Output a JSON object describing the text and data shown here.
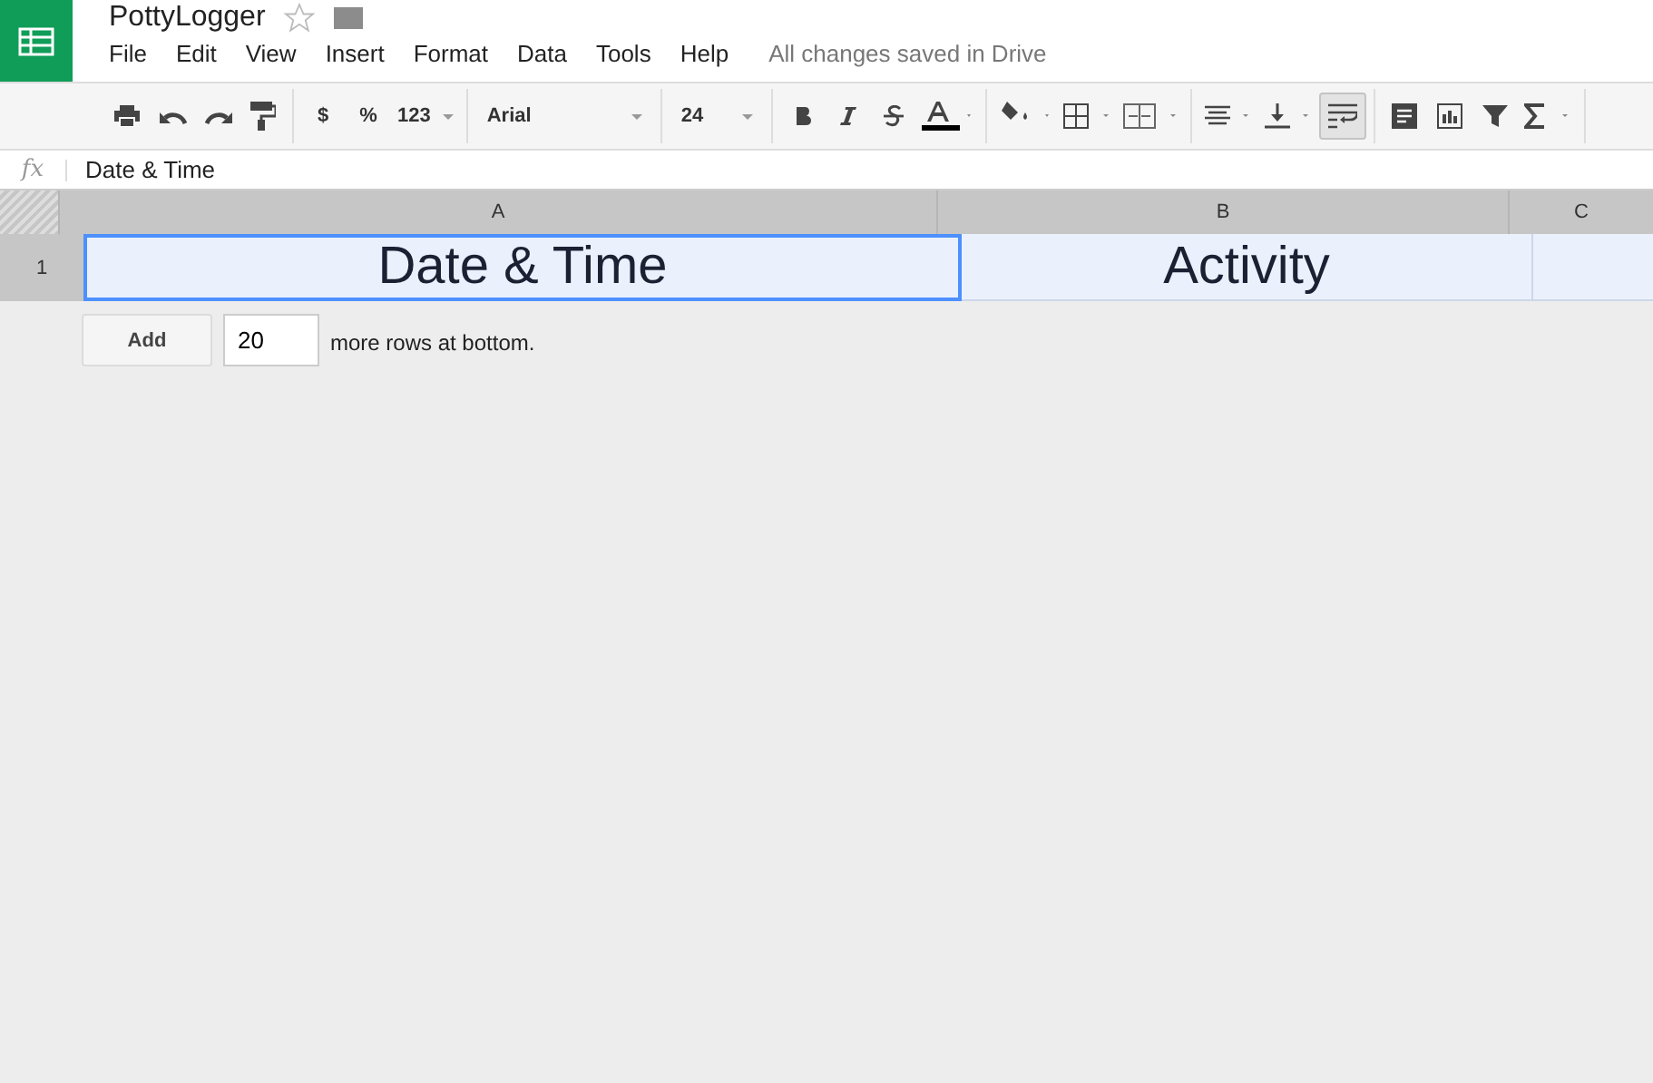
{
  "document": {
    "title": "PottyLogger",
    "starred": false
  },
  "menu": [
    "File",
    "Edit",
    "View",
    "Insert",
    "Format",
    "Data",
    "Tools",
    "Help"
  ],
  "save_status": "All changes saved in Drive",
  "toolbar": {
    "currency": "$",
    "percent": "%",
    "number_format": "123",
    "font": "Arial",
    "font_size": "24",
    "text_wrap": {
      "selected": true
    }
  },
  "formula_bar": {
    "label": "fx",
    "value": "Date & Time"
  },
  "sheet": {
    "columns": [
      {
        "label": "A"
      },
      {
        "label": "B"
      },
      {
        "label": "C"
      }
    ],
    "rows": [
      {
        "label": "1",
        "cells": [
          {
            "text": "Date & Time",
            "selected": true
          },
          {
            "text": "Activity",
            "selected": false
          },
          {
            "selected": false
          }
        ]
      }
    ]
  },
  "add_rows": {
    "button": "Add",
    "value": "20",
    "label": "more rows at bottom."
  }
}
